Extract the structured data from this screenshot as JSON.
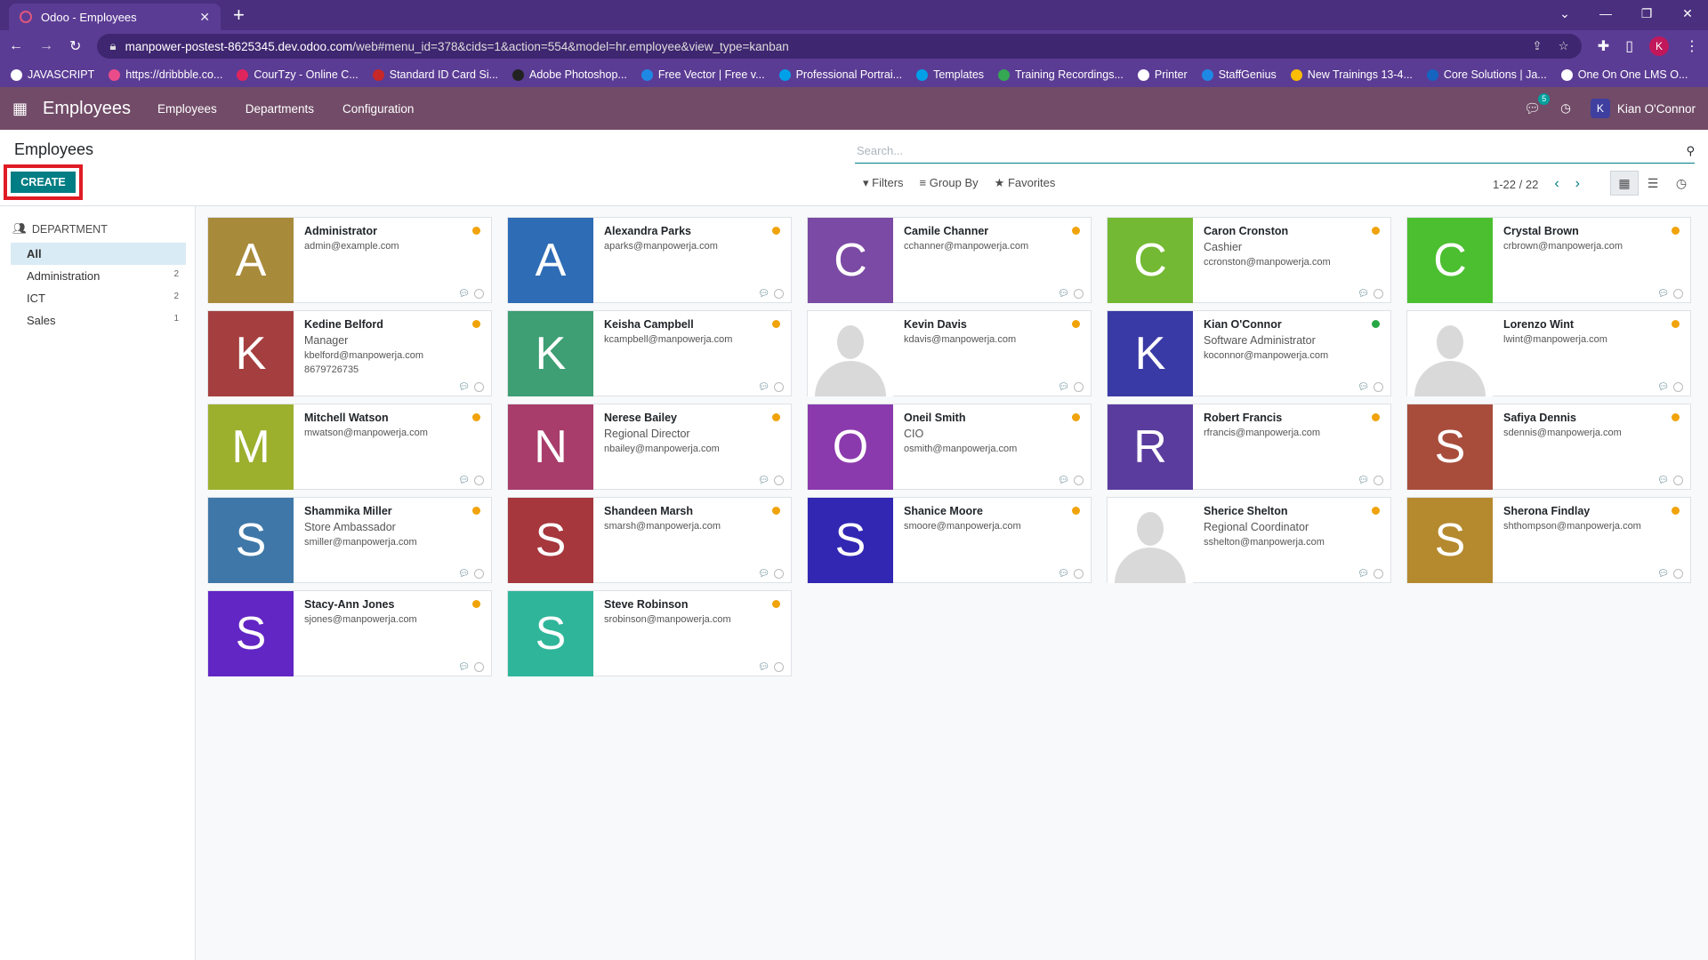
{
  "browser": {
    "tab_title": "Odoo - Employees",
    "url_host": "manpower-postest-8625345.dev.odoo.com",
    "url_path": "/web#menu_id=378&cids=1&action=554&model=hr.employee&view_type=kanban",
    "profile_initial": "K",
    "bookmarks": [
      {
        "label": "JAVASCRIPT",
        "color": "#ffffff"
      },
      {
        "label": "https://dribbble.co...",
        "color": "#ea4c89"
      },
      {
        "label": "CourTzy - Online C...",
        "color": "#e0245e"
      },
      {
        "label": "Standard ID Card Si...",
        "color": "#c62828"
      },
      {
        "label": "Adobe Photoshop...",
        "color": "#222222"
      },
      {
        "label": "Free Vector | Free v...",
        "color": "#1e88e5"
      },
      {
        "label": "Professional Portrai...",
        "color": "#00a0e9"
      },
      {
        "label": "Templates",
        "color": "#00a0e9"
      },
      {
        "label": "Training Recordings...",
        "color": "#34a853"
      },
      {
        "label": "Printer",
        "color": "#ffffff"
      },
      {
        "label": "StaffGenius",
        "color": "#1e88e5"
      },
      {
        "label": "New Trainings 13-4...",
        "color": "#fbbc04"
      },
      {
        "label": "Core Solutions | Ja...",
        "color": "#1565c0"
      },
      {
        "label": "One On One LMS O...",
        "color": "#ffffff"
      }
    ]
  },
  "nav": {
    "app_name": "Employees",
    "menu": [
      "Employees",
      "Departments",
      "Configuration"
    ],
    "chat_count": "5",
    "user_initial": "K",
    "user_name": "Kian O'Connor"
  },
  "control": {
    "breadcrumb": "Employees",
    "create_label": "CREATE",
    "search_placeholder": "Search...",
    "filters_label": "Filters",
    "groupby_label": "Group By",
    "favorites_label": "Favorites",
    "pager": "1-22 / 22"
  },
  "sidepanel": {
    "header": "DEPARTMENT",
    "items": [
      {
        "label": "All",
        "count": ""
      },
      {
        "label": "Administration",
        "count": "2"
      },
      {
        "label": "ICT",
        "count": "2"
      },
      {
        "label": "Sales",
        "count": "1"
      }
    ]
  },
  "employees": [
    {
      "initial": "A",
      "color": "#a88a3b",
      "name": "Administrator",
      "job": "",
      "email": "admin@example.com",
      "phone": "",
      "status": "#f0a30a"
    },
    {
      "initial": "A",
      "color": "#2e6cb5",
      "name": "Alexandra Parks",
      "job": "",
      "email": "aparks@manpowerja.com",
      "phone": "",
      "status": "#f0a30a"
    },
    {
      "initial": "C",
      "color": "#7b4aa4",
      "name": "Camile Channer",
      "job": "",
      "email": "cchanner@manpowerja.com",
      "phone": "",
      "status": "#f0a30a"
    },
    {
      "initial": "C",
      "color": "#74b933",
      "name": "Caron Cronston",
      "job": "Cashier",
      "email": "ccronston@manpowerja.com",
      "phone": "",
      "status": "#f0a30a"
    },
    {
      "initial": "C",
      "color": "#4cbf30",
      "name": "Crystal Brown",
      "job": "",
      "email": "crbrown@manpowerja.com",
      "phone": "",
      "status": "#f0a30a"
    },
    {
      "initial": "K",
      "color": "#a53f3f",
      "name": "Kedine Belford",
      "job": "Manager",
      "email": "kbelford@manpowerja.com",
      "phone": "8679726735",
      "status": "#f0a30a"
    },
    {
      "initial": "K",
      "color": "#3e9e74",
      "name": "Keisha Campbell",
      "job": "",
      "email": "kcampbell@manpowerja.com",
      "phone": "",
      "status": "#f0a30a"
    },
    {
      "initial": "",
      "color": "",
      "name": "Kevin Davis",
      "job": "",
      "email": "kdavis@manpowerja.com",
      "phone": "",
      "status": "#f0a30a"
    },
    {
      "initial": "K",
      "color": "#3a3aa6",
      "name": "Kian O'Connor",
      "job": "Software Administrator",
      "email": "koconnor@manpowerja.com",
      "phone": "",
      "status": "#28a745"
    },
    {
      "initial": "",
      "color": "",
      "name": "Lorenzo Wint",
      "job": "",
      "email": "lwint@manpowerja.com",
      "phone": "",
      "status": "#f0a30a"
    },
    {
      "initial": "M",
      "color": "#9cb02e",
      "name": "Mitchell Watson",
      "job": "",
      "email": "mwatson@manpowerja.com",
      "phone": "",
      "status": "#f0a30a"
    },
    {
      "initial": "N",
      "color": "#a83d6b",
      "name": "Nerese Bailey",
      "job": "Regional Director",
      "email": "nbailey@manpowerja.com",
      "phone": "",
      "status": "#f0a30a"
    },
    {
      "initial": "O",
      "color": "#8b3aad",
      "name": "Oneil Smith",
      "job": "CIO",
      "email": "osmith@manpowerja.com",
      "phone": "",
      "status": "#f0a30a"
    },
    {
      "initial": "R",
      "color": "#5a3c9e",
      "name": "Robert Francis",
      "job": "",
      "email": "rfrancis@manpowerja.com",
      "phone": "",
      "status": "#f0a30a"
    },
    {
      "initial": "S",
      "color": "#a84d3c",
      "name": "Safiya Dennis",
      "job": "",
      "email": "sdennis@manpowerja.com",
      "phone": "",
      "status": "#f0a30a"
    },
    {
      "initial": "S",
      "color": "#3f78a8",
      "name": "Shammika Miller",
      "job": "Store Ambassador",
      "email": "smiller@manpowerja.com",
      "phone": "",
      "status": "#f0a30a"
    },
    {
      "initial": "S",
      "color": "#a6373d",
      "name": "Shandeen Marsh",
      "job": "",
      "email": "smarsh@manpowerja.com",
      "phone": "",
      "status": "#f0a30a"
    },
    {
      "initial": "S",
      "color": "#3227b3",
      "name": "Shanice Moore",
      "job": "",
      "email": "smoore@manpowerja.com",
      "phone": "",
      "status": "#f0a30a"
    },
    {
      "initial": "",
      "color": "",
      "name": "Sherice Shelton",
      "job": "Regional Coordinator",
      "email": "sshelton@manpowerja.com",
      "phone": "",
      "status": "#f0a30a"
    },
    {
      "initial": "S",
      "color": "#b58a2f",
      "name": "Sherona Findlay",
      "job": "",
      "email": "shthompson@manpowerja.com",
      "phone": "",
      "status": "#f0a30a"
    },
    {
      "initial": "S",
      "color": "#6226c4",
      "name": "Stacy-Ann Jones",
      "job": "",
      "email": "sjones@manpowerja.com",
      "phone": "",
      "status": "#f0a30a"
    },
    {
      "initial": "S",
      "color": "#2fb59a",
      "name": "Steve Robinson",
      "job": "",
      "email": "srobinson@manpowerja.com",
      "phone": "",
      "status": "#f0a30a"
    }
  ]
}
